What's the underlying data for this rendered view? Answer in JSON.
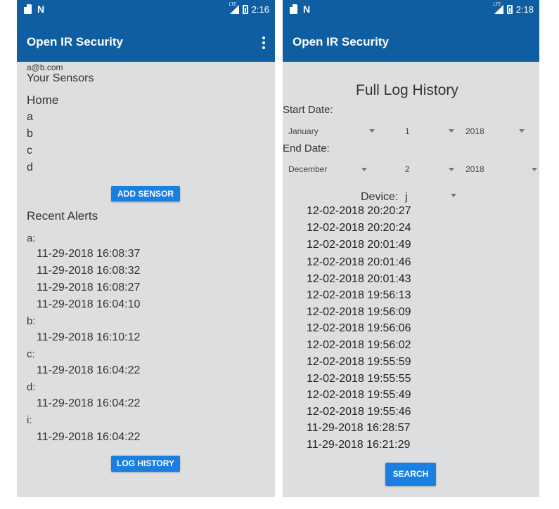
{
  "left": {
    "status": {
      "time": "2:16",
      "lte": "LTE"
    },
    "app_title": "Open IR Security",
    "email": "a@b.com",
    "your_sensors": "Your Sensors",
    "group": "Home",
    "sensors": [
      "a",
      "b",
      "c",
      "d"
    ],
    "add_sensor_label": "ADD SENSOR",
    "recent_alerts": "Recent Alerts",
    "alerts": [
      {
        "sensor": "a:",
        "times": [
          "11-29-2018 16:08:37",
          "11-29-2018 16:08:32",
          "11-29-2018 16:08:27",
          "11-29-2018 16:04:10"
        ]
      },
      {
        "sensor": "b:",
        "times": [
          "11-29-2018 16:10:12"
        ]
      },
      {
        "sensor": "c:",
        "times": [
          "11-29-2018 16:04:22"
        ]
      },
      {
        "sensor": "d:",
        "times": [
          "11-29-2018 16:04:22"
        ]
      },
      {
        "sensor": "i:",
        "times": [
          "11-29-2018 16:04:22"
        ]
      }
    ],
    "log_history_label": "LOG HISTORY"
  },
  "right": {
    "status": {
      "time": "2:18",
      "lte": "LTE"
    },
    "app_title": "Open IR Security",
    "heading": "Full Log History",
    "start_date_label": "Start Date:",
    "start": {
      "month": "January",
      "day": "1",
      "year": "2018"
    },
    "end_date_label": "End Date:",
    "end": {
      "month": "December",
      "day": "2",
      "year": "2018"
    },
    "device_label": "Device:",
    "device_value": "j",
    "log_entries": [
      "12-02-2018 20:20:27",
      "12-02-2018 20:20:24",
      "12-02-2018 20:01:49",
      "12-02-2018 20:01:46",
      "12-02-2018 20:01:43",
      "12-02-2018 19:56:13",
      "12-02-2018 19:56:09",
      "12-02-2018 19:56:06",
      "12-02-2018 19:56:02",
      "12-02-2018 19:55:59",
      "12-02-2018 19:55:55",
      "12-02-2018 19:55:49",
      "12-02-2018 19:55:46",
      "11-29-2018 16:28:57",
      "11-29-2018 16:21:29"
    ],
    "search_label": "SEARCH"
  },
  "colors": {
    "app_bar": "#0f5ea1",
    "button": "#1a7fe0",
    "background": "#dcdee0"
  },
  "icons": [
    "sd-card-icon",
    "n-notification-icon",
    "signal-icon",
    "battery-icon",
    "overflow-menu-icon",
    "dropdown-arrow-icon"
  ]
}
